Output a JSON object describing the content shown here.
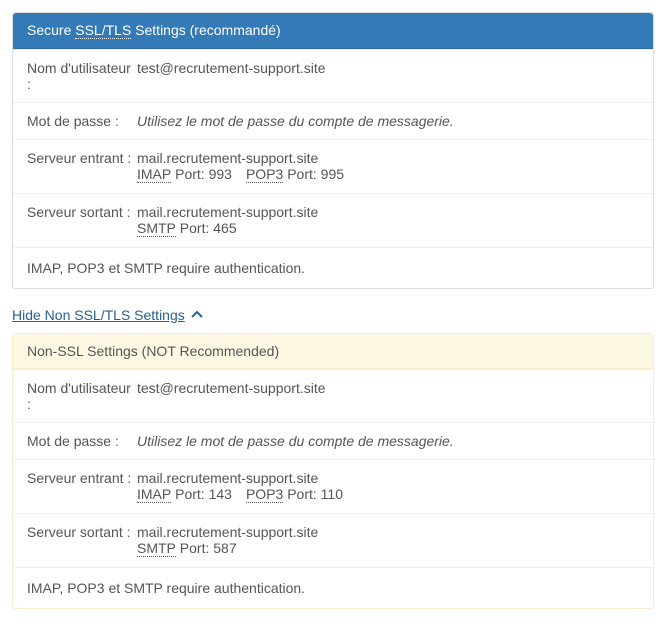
{
  "secure": {
    "heading_prefix": "Secure ",
    "heading_abbr": "SSL/TLS",
    "heading_suffix": " Settings (recommandé)",
    "username_label": "Nom d'utilisateur :",
    "username_value": "test@recrutement-support.site",
    "password_label": "Mot de passe :",
    "password_value": "Utilisez le mot de passe du compte de messagerie.",
    "incoming_label": "Serveur entrant :",
    "incoming_server": "mail.recrutement-support.site",
    "imap_abbr": "IMAP",
    "imap_port_label": " Port: ",
    "imap_port": "993",
    "pop3_abbr": "POP3",
    "pop3_port_label": " Port: ",
    "pop3_port": "995",
    "outgoing_label": "Serveur sortant :",
    "outgoing_server": "mail.recrutement-support.site",
    "smtp_abbr": "SMTP",
    "smtp_port_label": " Port: ",
    "smtp_port": "465",
    "auth_note": "IMAP, POP3 et SMTP require authentication."
  },
  "toggle": {
    "label": "Hide Non SSL/TLS Settings "
  },
  "nonssl": {
    "heading": "Non-SSL Settings (NOT Recommended)",
    "username_label": "Nom d'utilisateur :",
    "username_value": "test@recrutement-support.site",
    "password_label": "Mot de passe :",
    "password_value": "Utilisez le mot de passe du compte de messagerie.",
    "incoming_label": "Serveur entrant :",
    "incoming_server": "mail.recrutement-support.site",
    "imap_abbr": "IMAP",
    "imap_port_label": " Port: ",
    "imap_port": "143",
    "pop3_abbr": "POP3",
    "pop3_port_label": " Port: ",
    "pop3_port": "110",
    "outgoing_label": "Serveur sortant :",
    "outgoing_server": "mail.recrutement-support.site",
    "smtp_abbr": "SMTP",
    "smtp_port_label": " Port: ",
    "smtp_port": "587",
    "auth_note": "IMAP, POP3 et SMTP require authentication."
  }
}
